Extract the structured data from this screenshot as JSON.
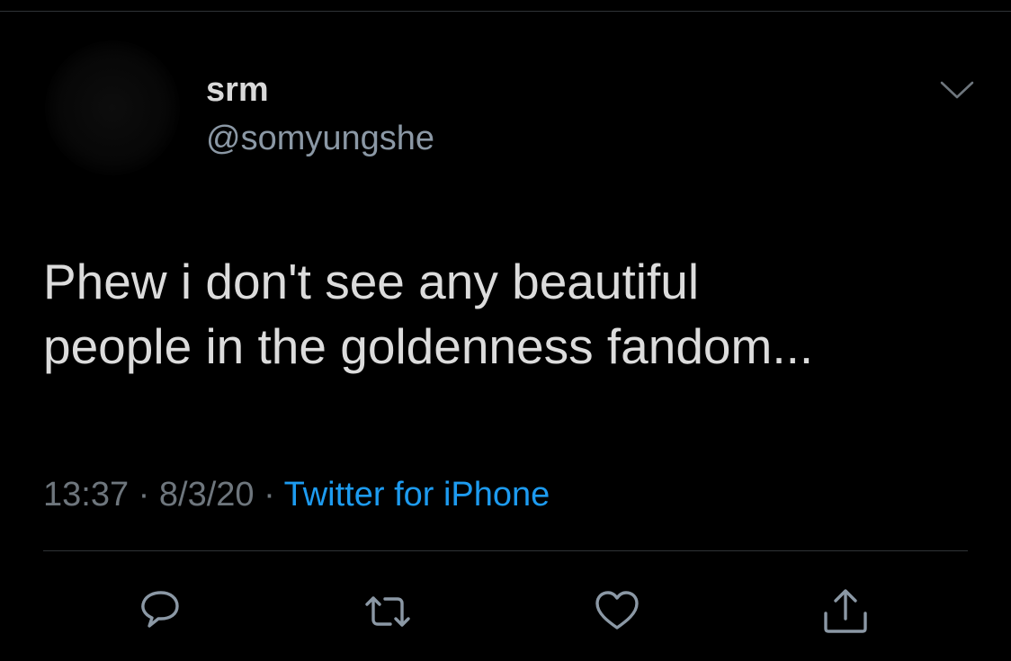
{
  "tweet": {
    "display_name": "srm",
    "handle": "@somyungshe",
    "text_line1": "Phew i don't see any beautiful",
    "text_line2": "people in the goldenness fandom...",
    "time": "13:37",
    "separator1": " · ",
    "date": "8/3/20",
    "separator2": " · ",
    "source": "Twitter for iPhone"
  },
  "icons": {
    "menu": "chevron-down-icon",
    "reply": "reply-icon",
    "retweet": "retweet-icon",
    "like": "heart-icon",
    "share": "share-icon"
  },
  "colors": {
    "background": "#000000",
    "text": "#d9d9d9",
    "secondary": "#8b98a5",
    "link": "#1d9bf0",
    "divider": "#2f3336"
  }
}
